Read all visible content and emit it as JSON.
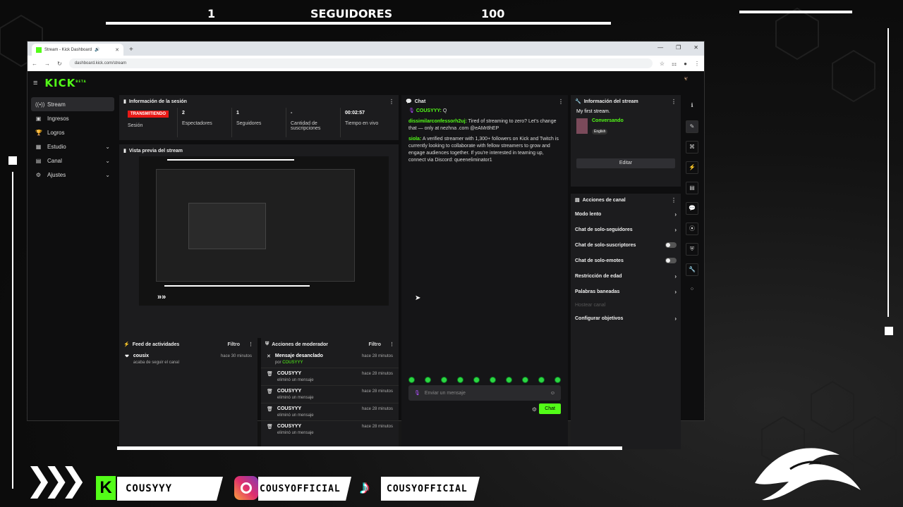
{
  "overlay": {
    "top_left_num": "1",
    "top_label": "SEGUIDORES",
    "top_right_num": "100",
    "social_kick": "COUSYYY",
    "social_instagram": "COUSYOFFICIAL",
    "social_tiktok": "COUSYOFFICIAL"
  },
  "browser": {
    "tab_title": "Stream - Kick Dashboard",
    "url": "dashboard.kick.com/stream"
  },
  "sidebar": {
    "items": [
      {
        "label": "Stream",
        "icon": "broadcast-icon"
      },
      {
        "label": "Ingresos",
        "icon": "money-icon"
      },
      {
        "label": "Logros",
        "icon": "trophy-icon"
      },
      {
        "label": "Estudio",
        "icon": "studio-icon"
      },
      {
        "label": "Canal",
        "icon": "channel-icon"
      },
      {
        "label": "Ajustes",
        "icon": "gear-icon"
      }
    ]
  },
  "session": {
    "title": "Información de la sesión",
    "live_badge": "TRANSMITIENDO",
    "live_label": "Sesión",
    "viewers_val": "2",
    "viewers_label": "Espectadores",
    "followers_val": "1",
    "followers_label": "Seguidores",
    "subs_val": "-",
    "subs_label": "Cantidad de suscripciones",
    "time_val": "00:02:57",
    "time_label": "Tiempo en vivo"
  },
  "preview": {
    "title": "Vista previa del stream"
  },
  "feed": {
    "title": "Feed de actividades",
    "filter": "Filtro",
    "items": [
      {
        "user": "cousix",
        "text": "acaba de seguir el canal",
        "time": "hace 30 minutos"
      }
    ]
  },
  "mod": {
    "title": "Acciones de moderador",
    "filter": "Filtro",
    "items": [
      {
        "title": "Mensaje desanclado",
        "by": "por ",
        "byuser": "COUSYYY",
        "time": "hace 28 minutos"
      },
      {
        "title": "COUSYYY",
        "by": "eliminó un mensaje",
        "byuser": "",
        "time": "hace 28 minutos"
      },
      {
        "title": "COUSYYY",
        "by": "eliminó un mensaje",
        "byuser": "",
        "time": "hace 28 minutos"
      },
      {
        "title": "COUSYYY",
        "by": "eliminó un mensaje",
        "byuser": "",
        "time": "hace 28 minutos"
      },
      {
        "title": "COUSYYY",
        "by": "eliminó un mensaje",
        "byuser": "",
        "time": "hace 28 minutos"
      }
    ]
  },
  "chat": {
    "title": "Chat",
    "messages": [
      {
        "user": "COUSYYY:",
        "text": " Q"
      },
      {
        "user": "dissimilarconfessorh2uj:",
        "text": " Tired of streaming to zero? Let's change that — only at nezhna .com @eAMr8hEP"
      },
      {
        "user": "siola:",
        "text": " A verified streamer with 1,300+ followers on Kick and Twitch is currently looking to collaborate with fellow streamers to grow and engage audiences together.  If you're interested in teaming up, connect via Discord: queeneliminator1"
      }
    ],
    "placeholder": "Enviar un mensaje",
    "send": "Chat"
  },
  "streaminfo": {
    "title": "Información del stream",
    "stream_title": "My first stream.",
    "category": "Conversando",
    "language": "English",
    "edit": "Editar"
  },
  "channel_actions": {
    "title": "Acciones de canal",
    "items": [
      {
        "label": "Modo lento",
        "kind": "chev"
      },
      {
        "label": "Chat de solo-seguidores",
        "kind": "chev"
      },
      {
        "label": "Chat de solo-suscriptores",
        "kind": "toggle"
      },
      {
        "label": "Chat de solo-emotes",
        "kind": "toggle"
      },
      {
        "label": "Restricción de edad",
        "kind": "chev"
      },
      {
        "label": "Palabras baneadas",
        "kind": "chev"
      },
      {
        "label": "Hostear canal",
        "kind": "dim"
      },
      {
        "label": "Configurar objetivos",
        "kind": "chev"
      }
    ]
  },
  "colors": {
    "kick_green": "#53fc18",
    "live_red": "#e91916"
  }
}
